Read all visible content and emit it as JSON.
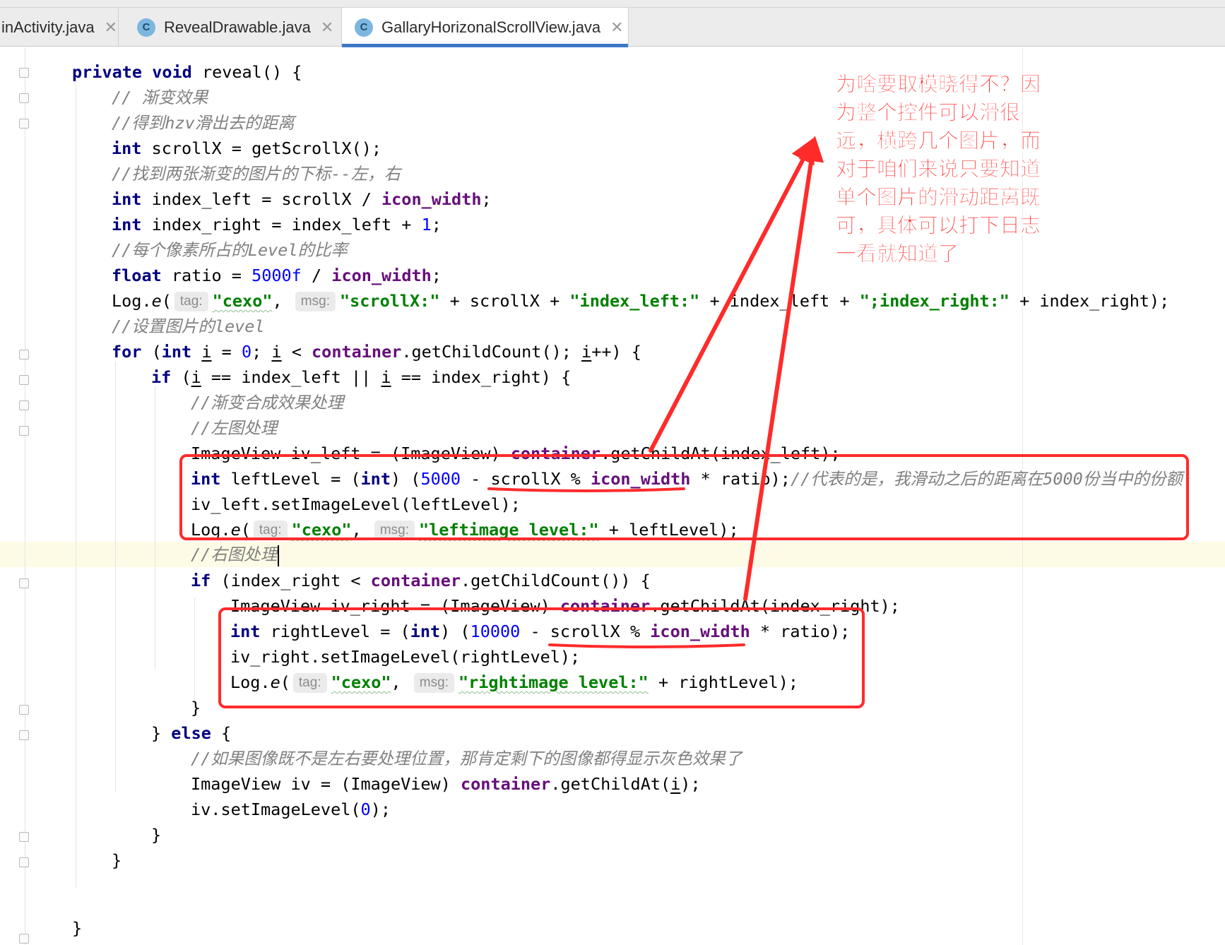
{
  "tabs": [
    {
      "label": "inActivity.java",
      "icon": "",
      "active": false
    },
    {
      "label": "RevealDrawable.java",
      "icon": "C",
      "active": false
    },
    {
      "label": "GallaryHorizonalScrollView.java",
      "icon": "C",
      "active": true
    }
  ],
  "hints": {
    "tag": "tag:",
    "msg": "msg:"
  },
  "code": {
    "l1": {
      "kw1": "private",
      "kw2": "void",
      "rest": " reveal() {"
    },
    "l2": "// 渐变效果",
    "l3": "//得到hzv滑出去的距离",
    "l4": {
      "kw": "int",
      "rest": " scrollX = getScrollX();"
    },
    "l5": "//找到两张渐变的图片的下标--左，右",
    "l6": {
      "kw": "int",
      "a": " index_left = scrollX / ",
      "fld": "icon_width",
      "b": ";"
    },
    "l7": {
      "kw": "int",
      "a": " index_right = index_left + ",
      "num": "1",
      "b": ";"
    },
    "l8": "//每个像素所占的Level的比率",
    "l9": {
      "kw": "float",
      "a": " ratio = ",
      "num": "5000f",
      "b": " / ",
      "fld": "icon_width",
      "c": ";"
    },
    "l10": {
      "a": "Log.",
      "e": "e",
      "b": "(",
      "s1": "\"cexo\"",
      "c": ", ",
      "s2": "\"scrollX:\"",
      "d": " + scrollX + ",
      "s3": "\"index_left:\"",
      "f": " + index_left + ",
      "s4": "\";index_right:\"",
      "g": " + index_right);"
    },
    "l11": "//设置图片的level",
    "l12": {
      "kw1": "for",
      "a": " (",
      "kw2": "int",
      "b": " ",
      "i1": "i",
      "c": " = ",
      "num": "0",
      "d": "; ",
      "i2": "i",
      "e": " < ",
      "fld": "container",
      "f": ".getChildCount(); ",
      "i3": "i",
      "g": "++) {"
    },
    "l13": {
      "kw": "if",
      "a": " (",
      "i1": "i",
      "b": " == index_left || ",
      "i2": "i",
      "c": " == index_right) {"
    },
    "l14": "//渐变合成效果处理",
    "l15": "//左图处理",
    "l16": {
      "a": "ImageView iv_left = (ImageView) ",
      "fld": "container",
      "b": ".getChildAt(index_left);"
    },
    "l17": {
      "kw1": "int",
      "a": " leftLevel = (",
      "kw2": "int",
      "b": ") (",
      "num": "5000",
      "c": " - scrollX % ",
      "fld": "icon_width",
      "d": " * ratio);",
      "cmt": "//代表的是，我滑动之后的距离在5000份当中的份额"
    },
    "l18": "iv_left.setImageLevel(leftLevel);",
    "l19": {
      "a": "Log.",
      "e": "e",
      "b": "(",
      "s1": "\"cexo\"",
      "c": ", ",
      "s2": "\"leftimage level:\"",
      "d": " + leftLevel);"
    },
    "l20": "//右图处理",
    "l21": {
      "kw": "if",
      "a": " (index_right < ",
      "fld": "container",
      "b": ".getChildCount()) {"
    },
    "l22": {
      "a": "ImageView iv_right = (ImageView) ",
      "fld": "container",
      "b": ".getChildAt(index_right);"
    },
    "l23": {
      "kw1": "int",
      "a": " rightLevel = (",
      "kw2": "int",
      "b": ") (",
      "num": "10000",
      "c": " - scrollX % ",
      "fld": "icon_width",
      "d": " * ratio);"
    },
    "l24": "iv_right.setImageLevel(rightLevel);",
    "l25": {
      "a": "Log.",
      "e": "e",
      "b": "(",
      "s1": "\"cexo\"",
      "c": ", ",
      "s2": "\"rightimage level:\"",
      "d": " + rightLevel);"
    },
    "l26": "}",
    "l27": {
      "a": "} ",
      "kw": "else",
      "b": " {"
    },
    "l28": "//如果图像既不是左右要处理位置，那肯定剩下的图像都得显示灰色效果了",
    "l29": {
      "a": "ImageView iv = (ImageView) ",
      "fld": "container",
      "b": ".getChildAt(",
      "i": "i",
      "c": ");"
    },
    "l30": {
      "a": "iv.setImageLevel(",
      "num": "0",
      "b": ");"
    },
    "l31": "}",
    "l32": "}",
    "l33": "}"
  },
  "annotation": {
    "note": "为啥要取模晓得不？因为整个控件可以滑很远，横跨几个图片，而对于咱们来说只要知道单个图片的滑动距离既可，具体可以打下日志一看就知道了",
    "color": "#ff2b2b"
  },
  "colors": {
    "keyword": "#000080",
    "number": "#0000ff",
    "string": "#008000",
    "field": "#660e7a",
    "comment": "#808080",
    "tab_accent": "#3d78c8"
  }
}
